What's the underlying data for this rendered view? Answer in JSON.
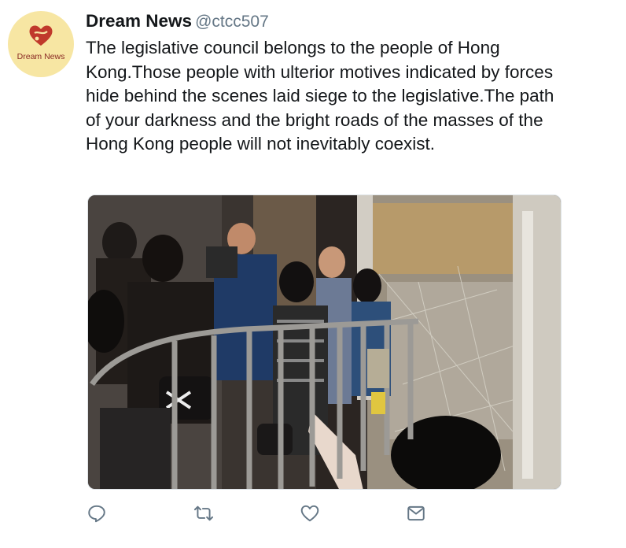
{
  "tweet": {
    "author_name": "Dream News",
    "author_handle": "@ctcc507",
    "text": "The legislative council belongs to the people of Hong Kong.Those people with ulterior motives indicated by forces hide behind the scenes laid siege to the legislative.The path of your darkness and the bright roads of the masses of the Hong Kong people will not inevitably coexist.",
    "avatar_label": "Dream News"
  },
  "actions": [
    {
      "name": "reply",
      "icon": "reply-icon"
    },
    {
      "name": "retweet",
      "icon": "retweet-icon"
    },
    {
      "name": "like",
      "icon": "heart-icon"
    },
    {
      "name": "message",
      "icon": "envelope-icon"
    }
  ],
  "colors": {
    "text": "#14171a",
    "secondary": "#657786",
    "icon": "#657786",
    "avatar_bg": "#f7e6a3",
    "brand_red": "#c0392b"
  }
}
